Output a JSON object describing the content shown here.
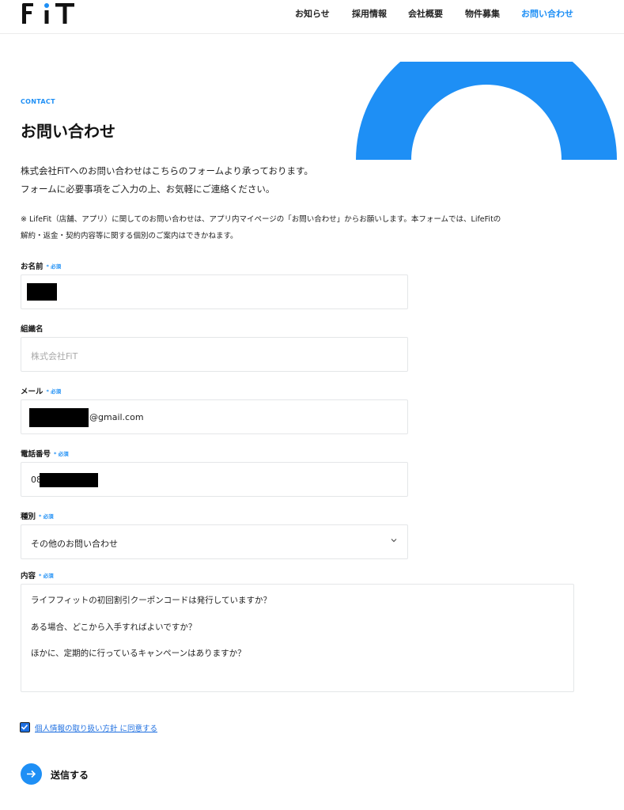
{
  "header": {
    "logo_text": "FiT",
    "nav": [
      {
        "label": "お知らせ",
        "active": false
      },
      {
        "label": "採用情報",
        "active": false
      },
      {
        "label": "会社概要",
        "active": false
      },
      {
        "label": "物件募集",
        "active": false
      },
      {
        "label": "お問い合わせ",
        "active": true
      }
    ]
  },
  "colors": {
    "accent": "#1e8ff5",
    "link": "#1e6fe0",
    "text": "#1a1a1a",
    "border": "#e4e6e8"
  },
  "intro": {
    "eyebrow": "CONTACT",
    "title": "お問い合わせ",
    "line1": "株式会社FiTへのお問い合わせはこちらのフォームより承っております。",
    "line2": "フォームに必要事項をご入力の上、お気軽にご連絡ください。",
    "notice_line1": "※ LifeFit（店舗、アプリ）に関してのお問い合わせは、アプリ内マイページの「お問い合わせ」からお願いします。本フォームでは、LifeFitの",
    "notice_line2": "解約・返金・契約内容等に関する個別のご案内はできかねます。"
  },
  "form": {
    "required_mark": "* 必須",
    "name": {
      "label": "お名前",
      "value": ""
    },
    "organization": {
      "label": "組織名",
      "placeholder": "株式会社FiT"
    },
    "email": {
      "label": "メール",
      "value_suffix": "@gmail.com"
    },
    "phone": {
      "label": "電話番号",
      "value_prefix": "08"
    },
    "category": {
      "label": "種別",
      "selected": "その他のお問い合わせ",
      "icon": "chevron-down-icon"
    },
    "content": {
      "label": "内容",
      "lines": [
        "ライフフィットの初回割引クーポンコードは発行していますか？",
        "ある場合、どこから入手すればよいですか？",
        "ほかに、定期的に行っているキャンペーンはありますか？"
      ]
    },
    "consent": {
      "label": "個人情報の取り扱い方針 に同意する",
      "checked": true
    },
    "submit": {
      "label": "送信する",
      "icon": "arrow-right-icon"
    }
  }
}
